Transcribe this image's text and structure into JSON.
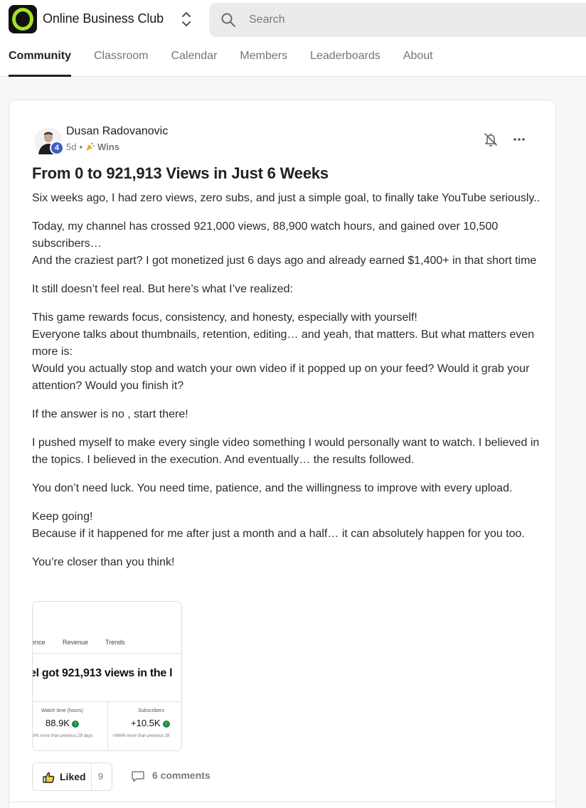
{
  "header": {
    "club_name": "Online Business Club",
    "search_placeholder": "Search",
    "brand_color": "#a4e22b",
    "tabs": [
      {
        "label": "Community",
        "active": true
      },
      {
        "label": "Classroom",
        "active": false
      },
      {
        "label": "Calendar",
        "active": false
      },
      {
        "label": "Members",
        "active": false
      },
      {
        "label": "Leaderboards",
        "active": false
      },
      {
        "label": "About",
        "active": false
      }
    ]
  },
  "post": {
    "author": "Dusan Radovanovic",
    "level": "4",
    "time": "5d",
    "separator": "•",
    "category_icon": "confetti-icon",
    "category": "Wins",
    "title": "From 0 to 921,913 Views in Just 6 Weeks",
    "paragraphs": [
      [
        "Six weeks ago, I had zero views, zero subs, and just a simple goal, to finally take YouTube seriously.."
      ],
      [
        "Today, my channel has crossed 921,000 views, 88,900 watch hours, and gained over 10,500 subscribers…",
        "And the craziest part? I got monetized just 6 days ago and already earned $1,400+ in that short time"
      ],
      [
        "It still doesn’t feel real. But here’s what I’ve realized:"
      ],
      [
        "This game rewards focus, consistency, and honesty, especially with yourself!",
        "Everyone talks about thumbnails, retention, editing… and yeah, that matters. But what matters even more is:",
        "Would you actually stop and watch your own video if it popped up on your feed? Would it grab your attention? Would you finish it?"
      ],
      [
        "If the answer is no , start there!"
      ],
      [
        "I pushed myself to make every single video something I would personally want to watch. I believed in the topics. I believed in the execution. And eventually… the results followed."
      ],
      [
        "You don’t need luck. You need time, patience, and the willingness to improve with every upload."
      ],
      [
        "Keep going!",
        "Because if it happened for me after just a month and a half… it can absolutely happen for you too."
      ],
      [
        "You’re closer than you think!"
      ]
    ],
    "attachment": {
      "tab_partial": "ence",
      "tab_revenue": "Revenue",
      "tab_trends": "Trends",
      "headline": "el got 921,913 views in the l",
      "stats": [
        {
          "label": "Watch time (hours)",
          "value": "88.9K",
          "sub": "9% more than previous 28 days"
        },
        {
          "label": "Subscribers",
          "value": "+10.5K",
          "sub": ">999% more than previous 28"
        }
      ]
    },
    "actions": {
      "like_label": "Liked",
      "like_count": "9",
      "comments_label": "6 comments"
    }
  }
}
